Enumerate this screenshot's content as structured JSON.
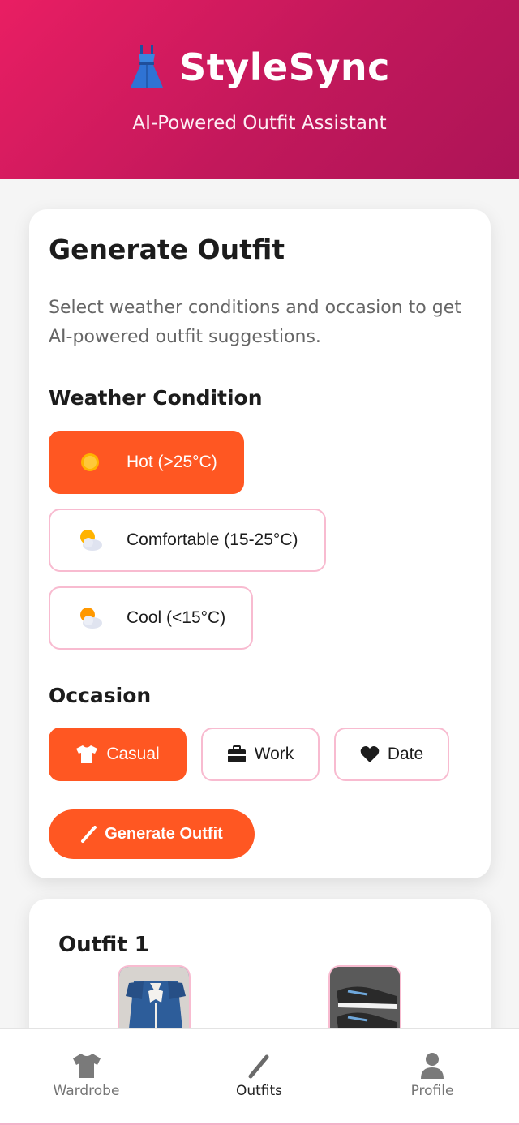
{
  "app": {
    "title": "StyleSync",
    "tagline": "AI-Powered Outfit Assistant",
    "logo_icon": "dress-icon"
  },
  "generate": {
    "title": "Generate Outfit",
    "description": "Select weather conditions and occasion to get AI-powered outfit suggestions.",
    "weather_title": "Weather Condition",
    "weather_options": [
      {
        "label": "Hot (>25°C)",
        "icon": "sun-icon",
        "selected": true
      },
      {
        "label": "Comfortable (15-25°C)",
        "icon": "sun-behind-cloud-icon",
        "selected": false
      },
      {
        "label": "Cool (<15°C)",
        "icon": "sun-behind-cloud-icon",
        "selected": false
      }
    ],
    "occasion_title": "Occasion",
    "occasion_options": [
      {
        "label": "Casual",
        "icon": "tshirt-icon",
        "selected": true
      },
      {
        "label": "Work",
        "icon": "briefcase-icon",
        "selected": false
      },
      {
        "label": "Date",
        "icon": "heart-icon",
        "selected": false
      }
    ],
    "generate_button": "Generate Outfit"
  },
  "outfit": {
    "title": "Outfit 1",
    "items": [
      "dress-thumbnail",
      "sneakers-thumbnail"
    ]
  },
  "nav": {
    "items": [
      {
        "label": "Wardrobe",
        "icon": "tshirt-icon",
        "active": false
      },
      {
        "label": "Outfits",
        "icon": "wand-icon",
        "active": true
      },
      {
        "label": "Profile",
        "icon": "user-icon",
        "active": false
      }
    ]
  },
  "colors": {
    "header_start": "#e91e63",
    "header_end": "#ad1457",
    "accent": "#ff5722",
    "border": "#f8bbd0"
  }
}
